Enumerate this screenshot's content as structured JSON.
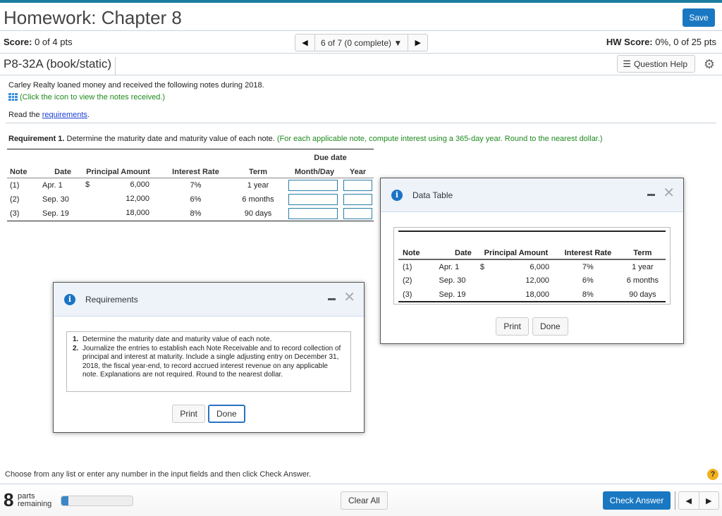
{
  "header": {
    "title": "Homework: Chapter 8",
    "save_label": "Save",
    "score_label": "Score:",
    "score_value": "0 of 4 pts",
    "nav_prev": "◀",
    "nav_position": "6 of 7 (0 complete) ▼",
    "nav_next": "▶",
    "hw_score_label": "HW Score:",
    "hw_score_value": "0%, 0 of 25 pts",
    "question_id": "P8-32A (book/static)",
    "question_help_label": "Question Help",
    "gear_glyph": "⚙"
  },
  "problem": {
    "intro": "Carley Realty loaned money and received the following notes during 2018.",
    "icon_hint": "(Click the icon to view the notes received.)",
    "read_prefix": "Read the ",
    "read_link": "requirements",
    "read_suffix": ".",
    "req_label": "Requirement 1.",
    "req_text": " Determine the maturity date and maturity value of each note.",
    "req_hint": " (For each applicable note, compute interest using a 365-day year. Round to the nearest dollar.)"
  },
  "main_table": {
    "group_header": "Due date",
    "headers": [
      "Note",
      "Date",
      "Principal Amount",
      "Interest Rate",
      "Term",
      "Month/Day",
      "Year"
    ],
    "rows": [
      {
        "note": "(1)",
        "date": "Apr. 1",
        "currency": "$",
        "principal": "6,000",
        "rate": "7%",
        "term": "1 year",
        "month_day": "",
        "year": ""
      },
      {
        "note": "(2)",
        "date": "Sep. 30",
        "currency": "",
        "principal": "12,000",
        "rate": "6%",
        "term": "6 months",
        "month_day": "",
        "year": ""
      },
      {
        "note": "(3)",
        "date": "Sep. 19",
        "currency": "",
        "principal": "18,000",
        "rate": "8%",
        "term": "90 days",
        "month_day": "",
        "year": ""
      }
    ]
  },
  "data_table_modal": {
    "title": "Data Table",
    "headers": [
      "Note",
      "Date",
      "Principal Amount",
      "Interest Rate",
      "Term"
    ],
    "rows": [
      {
        "note": "(1)",
        "date": "Apr. 1",
        "currency": "$",
        "principal": "6,000",
        "rate": "7%",
        "term": "1 year"
      },
      {
        "note": "(2)",
        "date": "Sep. 30",
        "currency": "",
        "principal": "12,000",
        "rate": "6%",
        "term": "6 months"
      },
      {
        "note": "(3)",
        "date": "Sep. 19",
        "currency": "",
        "principal": "18,000",
        "rate": "8%",
        "term": "90 days"
      }
    ],
    "print_label": "Print",
    "done_label": "Done"
  },
  "requirements_modal": {
    "title": "Requirements",
    "items": [
      {
        "num": "1.",
        "text": "Determine the maturity date and maturity value of each note."
      },
      {
        "num": "2.",
        "text": "Journalize the entries to establish each Note Receivable and to record collection of principal and interest at maturity. Include a single adjusting entry on December 31, 2018, the fiscal year-end, to record accrued interest revenue on any applicable note. Explanations are not required. Round to the nearest dollar."
      }
    ],
    "print_label": "Print",
    "done_label": "Done"
  },
  "footer": {
    "instruction": "Choose from any list or enter any number in the input fields and then click Check Answer.",
    "help_glyph": "?",
    "parts_count": "8",
    "parts_label_1": "parts",
    "parts_label_2": "remaining",
    "progress_fraction": 0.1,
    "clear_all_label": "Clear All",
    "check_answer_label": "Check Answer",
    "prev_glyph": "◀",
    "next_glyph": "▶"
  }
}
